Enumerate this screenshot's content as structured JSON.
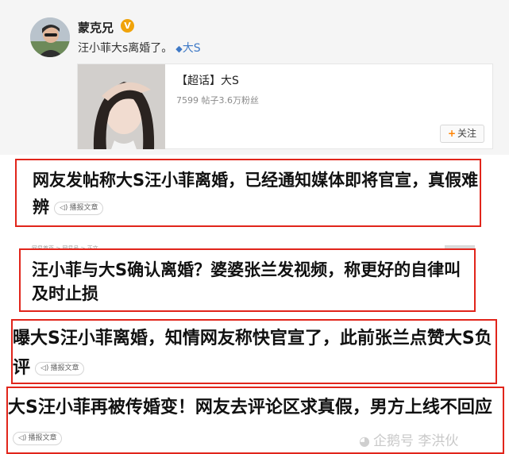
{
  "post": {
    "username": "蒙克兄",
    "verified_badge": "V",
    "text": "汪小菲大s离婚了。",
    "topic_link": "大S",
    "topic_card": {
      "title": "【超话】大S",
      "stats": "7599 帖子3.6万粉丝",
      "follow_label": "关注"
    }
  },
  "headlines": [
    {
      "text": "网友发帖称大S汪小菲离婚，已经通知媒体即将官宣，真假难辨",
      "read_label": "播报文章"
    },
    {
      "breadcrumb": "网易首页 > 网易号 > 正文",
      "text": "汪小菲与大S确认离婚？婆婆张兰发视频，称更好的自律叫及时止损"
    },
    {
      "text": "曝大S汪小菲离婚，知情网友称快官宣了，此前张兰点赞大S负评",
      "read_label": "播报文章"
    },
    {
      "text": "大S汪小菲再被传婚变！网友去评论区求真假，男方上线不回应",
      "read_label": "播报文章"
    }
  ],
  "watermark": "企鹅号 李洪伙",
  "colors": {
    "highlight_border": "#e1251b",
    "weibo_link": "#3f79c6",
    "verified": "#f0a30a",
    "follow_plus": "#ff8200"
  }
}
